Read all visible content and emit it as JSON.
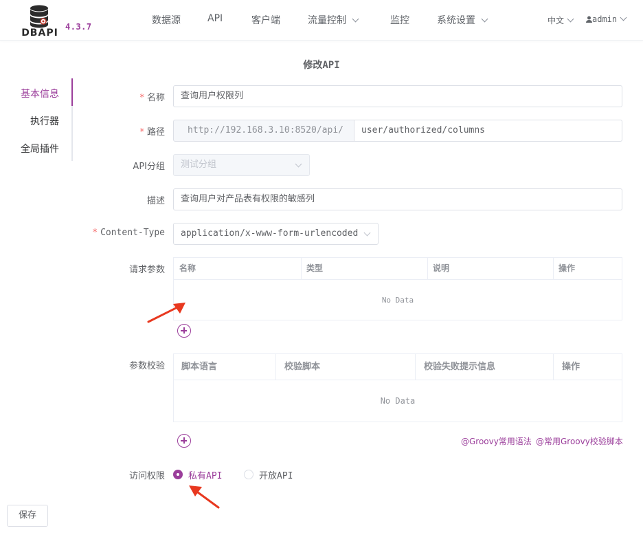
{
  "app": {
    "logo_text": "DBAPI",
    "version": "4.3.7"
  },
  "nav": {
    "items": [
      {
        "label": "数据源"
      },
      {
        "label": "API"
      },
      {
        "label": "客户端"
      },
      {
        "label": "流量控制"
      },
      {
        "label": "监控"
      },
      {
        "label": "系统设置"
      }
    ],
    "language": "中文",
    "user": "admin"
  },
  "page": {
    "title": "修改API"
  },
  "tabs": [
    {
      "label": "基本信息",
      "active": true
    },
    {
      "label": "执行器",
      "active": false
    },
    {
      "label": "全局插件",
      "active": false
    }
  ],
  "form": {
    "name": {
      "label": "名称",
      "value": "查询用户权限列"
    },
    "path": {
      "label": "路径",
      "prefix": "http://192.168.3.10:8520/api/",
      "value": "user/authorized/columns"
    },
    "group": {
      "label": "API分组",
      "value": "测试分组"
    },
    "desc": {
      "label": "描述",
      "value": "查询用户对产品表有权限的敏感列"
    },
    "content_type": {
      "label": "Content-Type",
      "value": "application/x-www-form-urlencoded"
    },
    "params": {
      "label": "请求参数",
      "columns": [
        "名称",
        "类型",
        "说明",
        "操作"
      ],
      "empty_text": "No Data"
    },
    "validation": {
      "label": "参数校验",
      "columns": [
        "脚本语言",
        "校验脚本",
        "校验失败提示信息",
        "操作"
      ],
      "empty_text": "No Data",
      "links": [
        "@Groovy常用语法",
        "@常用Groovy校验脚本"
      ]
    },
    "access": {
      "label": "访问权限",
      "options": [
        {
          "label": "私有API",
          "checked": true
        },
        {
          "label": "开放API",
          "checked": false
        }
      ]
    }
  },
  "actions": {
    "save_label": "保存"
  },
  "colors": {
    "accent": "#9b3e9b",
    "required": "#f56c6c",
    "annotation_arrow": "#e8381f"
  }
}
